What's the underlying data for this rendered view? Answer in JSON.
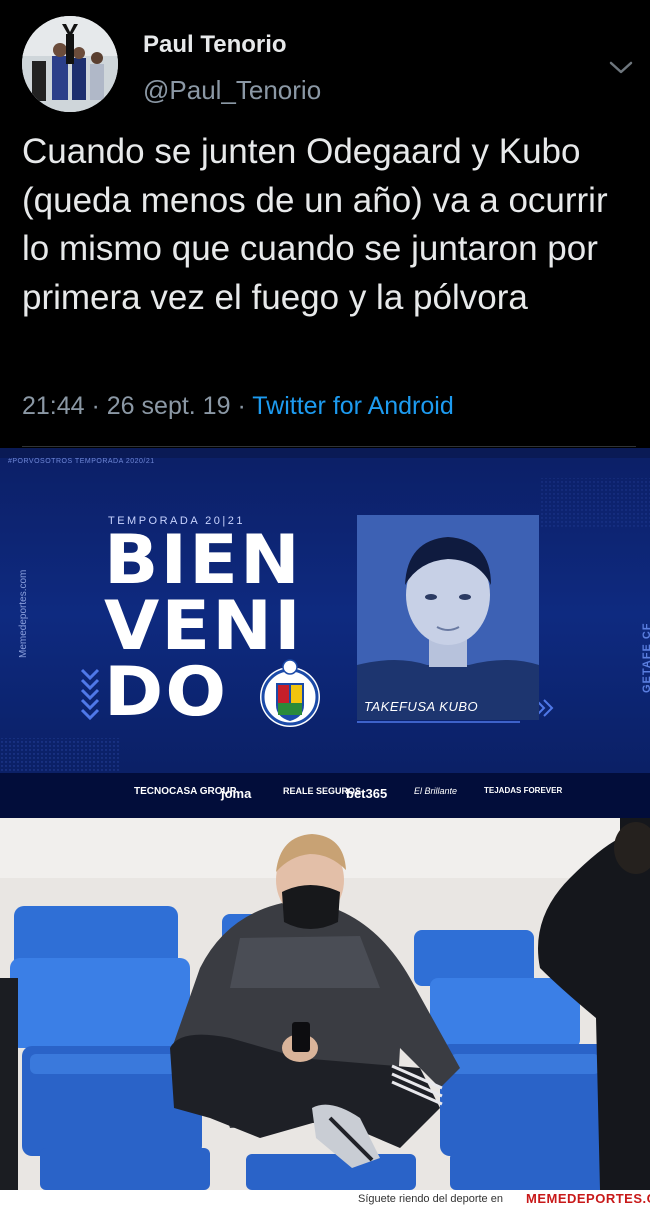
{
  "tweet": {
    "display_name": "Paul Tenorio",
    "handle": "@Paul_Tenorio",
    "text": "Cuando se junten Odegaard y Kubo (queda menos de un año) va a ocurrir lo mismo que cuando se juntaron por primera vez el fuego y la pólvora",
    "time": "21:44",
    "separator": " · ",
    "date": "26 sept. 19",
    "source": "Twitter for Android",
    "menu_icon": "chevron-down-icon",
    "colors": {
      "background": "#000000",
      "text": "#e7e9ea",
      "secondary": "#8b98a5",
      "link": "#1d9bf0"
    }
  },
  "banner": {
    "hashtag": "#PORVOSOTROS  TEMPORADA 2020/21",
    "watermark": "Memedeportes.com",
    "season": "TEMPORADA 20|21",
    "headline": [
      "BIEN",
      "VENI",
      "DO"
    ],
    "player_name": "TAKEFUSA KUBO",
    "club_vertical": "GETAFE CF",
    "crest_text": "GETAFE C.F. S.A.D.",
    "sponsors": [
      "TECNOCASA GROUP",
      "joma",
      "REALE SEGUROS",
      "bet365",
      "El Brillante",
      "TEJADAS FOREVER"
    ],
    "colors": {
      "primary": "#0e2a80",
      "dark": "#020d3a",
      "accent": "#3e63b7"
    }
  },
  "footer": {
    "text": "Síguete riendo del deporte en",
    "brand": "MEMEDEPORTES.COM"
  }
}
